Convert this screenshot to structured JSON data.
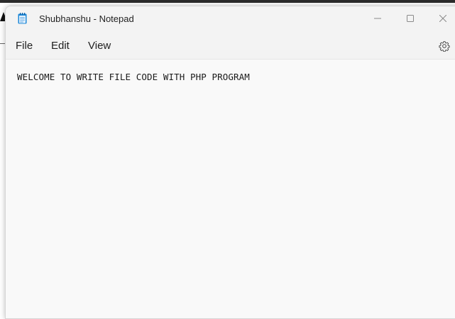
{
  "window": {
    "title": "Shubhanshu - Notepad",
    "app_icon": "notepad-icon",
    "controls": [
      "minimize-icon",
      "maximize-icon",
      "close-icon"
    ]
  },
  "menu": {
    "items": [
      {
        "label": "File"
      },
      {
        "label": "Edit"
      },
      {
        "label": "View"
      }
    ],
    "settings_icon": "gear-icon"
  },
  "editor": {
    "content": "WELCOME TO WRITE FILE CODE WITH PHP PROGRAM"
  },
  "colors": {
    "titlebar_bg": "#f3f3f3",
    "editor_bg": "#f9f9f9",
    "text": "#1a1a1a",
    "notepad_icon_blue": "#1e88d8"
  }
}
